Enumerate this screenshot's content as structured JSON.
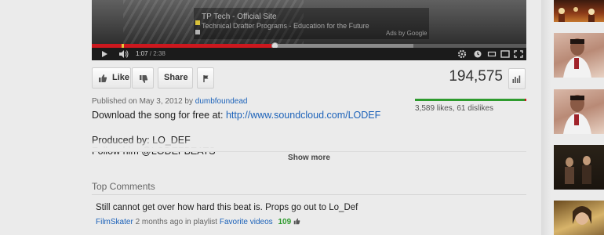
{
  "player": {
    "ad_title": "TP Tech - Official Site",
    "ad_text": "Technical Drafter Programs - Education for the Future",
    "ad_by": "Ads by Google",
    "current_time": "1:07",
    "duration": "2:38",
    "played_fraction": 0.42,
    "buffered_fraction": 0.74
  },
  "actions": {
    "like_label": "Like",
    "share_label": "Share"
  },
  "stats": {
    "view_count": "194,575",
    "likes_text": "3,589 likes, 61 dislikes",
    "like_ratio": 0.983
  },
  "description": {
    "published_prefix": "Published on May 3, 2012 by",
    "uploader": "dumbfoundead",
    "line1_text": "Download the song for free at:",
    "line1_link": "http://www.soundcloud.com/LODEF",
    "line2": "Produced by: LO_DEF",
    "line3": "Follow him @LODEFBEATS",
    "show_more": "Show more"
  },
  "comments": {
    "title": "Top Comments",
    "items": [
      {
        "text": "Still cannot get over how hard this beat is. Props go out to Lo_Def",
        "author": "FilmSkater",
        "time": "2 months ago in playlist",
        "playlist": "Favorite videos",
        "votes": "109"
      }
    ]
  },
  "colors": {
    "accent_red": "#cc181e",
    "like_green": "#2e9b2e",
    "link_blue": "#1c62b9"
  }
}
